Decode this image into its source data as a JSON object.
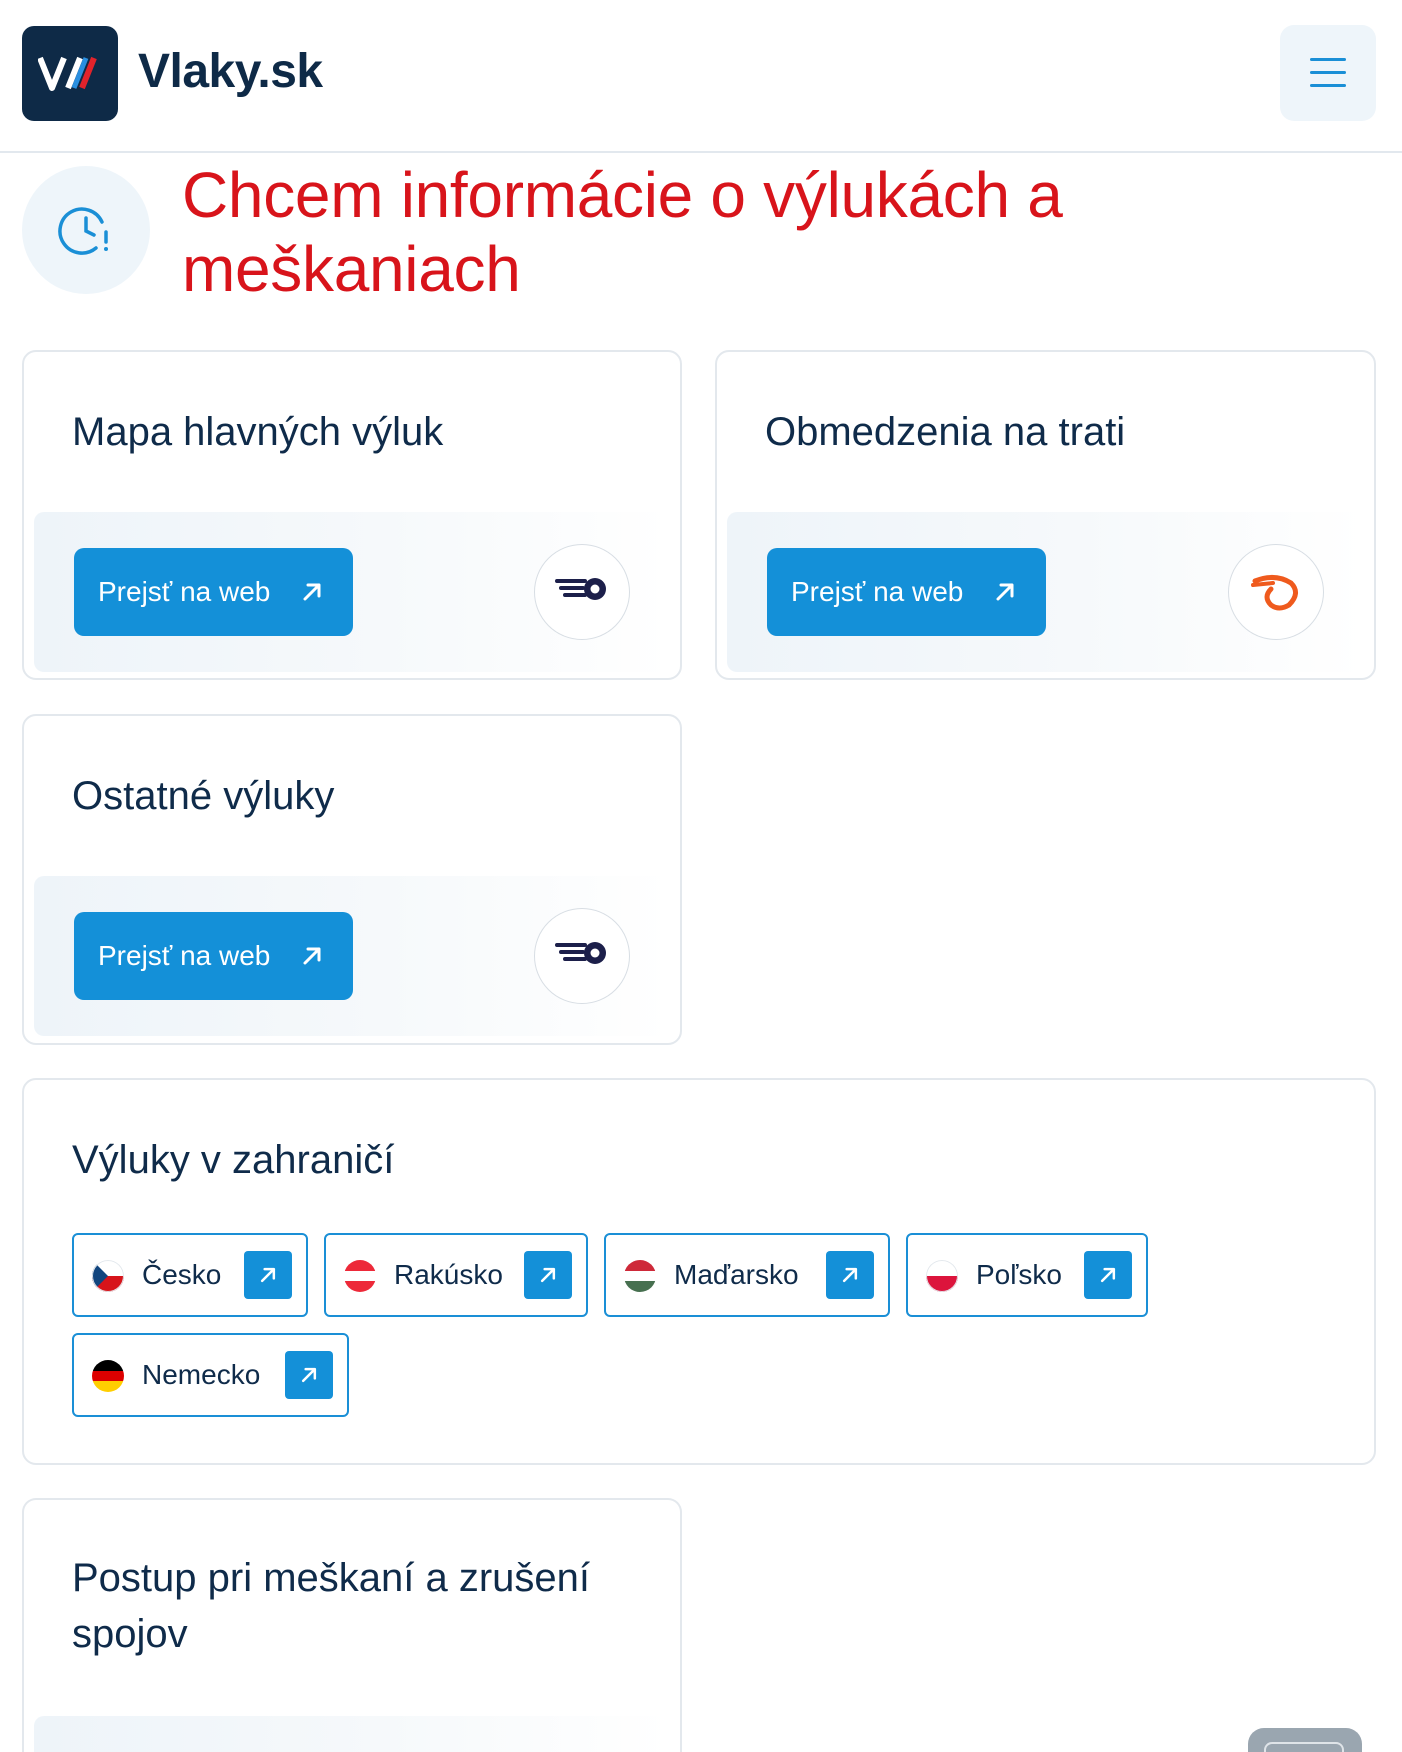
{
  "header": {
    "brand": "Vlaky.sk"
  },
  "page": {
    "title": "Chcem informácie o výlukách a meškaniach"
  },
  "cards": [
    {
      "title": "Mapa hlavných výluk",
      "button": "Prejsť na web",
      "provider_icon": "zssk-train-icon"
    },
    {
      "title": "Obmedzenia na trati",
      "button": "Prejsť na web",
      "provider_icon": "zsr-swirl-icon"
    },
    {
      "title": "Ostatné výluky",
      "button": "Prejsť na web",
      "provider_icon": "zssk-train-icon"
    }
  ],
  "abroad": {
    "title": "Výluky v zahraničí",
    "countries": [
      {
        "name": "Česko"
      },
      {
        "name": "Rakúsko"
      },
      {
        "name": "Maďarsko"
      },
      {
        "name": "Poľsko"
      },
      {
        "name": "Nemecko"
      }
    ]
  },
  "delay_card": {
    "title": "Postup pri meškaní a zrušení spojov"
  },
  "colors": {
    "title_red": "#d8141b",
    "button_blue": "#1490d8",
    "navy": "#0e2a47"
  }
}
